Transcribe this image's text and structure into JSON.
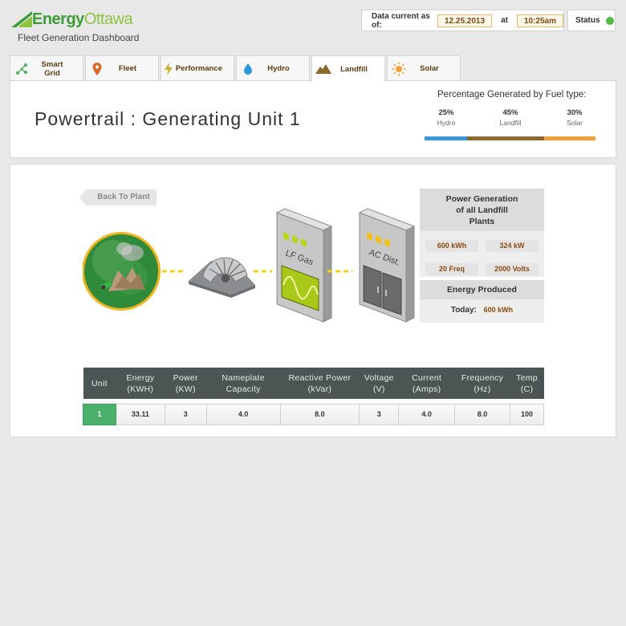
{
  "header": {
    "brand_energy": "Energy",
    "brand_city": "Ottawa",
    "subtitle": "Fleet Generation Dashboard",
    "data_current_label": "Data current as of:",
    "date": "12.25.2013",
    "at_label": "at",
    "time": "10:25am",
    "status_label": "Status",
    "status_color": "#56b848"
  },
  "tabs": [
    {
      "label": "Smart Grid",
      "icon": "network-icon"
    },
    {
      "label": "Fleet",
      "icon": "map-pin-icon"
    },
    {
      "label": "Performance",
      "icon": "lightning-icon"
    },
    {
      "label": "Hydro",
      "icon": "water-drop-icon"
    },
    {
      "label": "Landfill",
      "icon": "landfill-hill-icon",
      "active": true
    },
    {
      "label": "Solar",
      "icon": "sun-icon"
    }
  ],
  "unit": {
    "title": "Powertrail : Generating Unit 1"
  },
  "fuel": {
    "title": "Percentage Generated by Fuel type:",
    "items": [
      {
        "value": "25%",
        "name": "Hydro",
        "fraction": 0.25,
        "color": "#3a9ad9"
      },
      {
        "value": "45%",
        "name": "Landfill",
        "fraction": 0.45,
        "color": "#8a6a2c"
      },
      {
        "value": "30%",
        "name": "Solar",
        "fraction": 0.3,
        "color": "#f0a13a"
      }
    ]
  },
  "diagram": {
    "back_label": "Back To Plant",
    "cabinet1_label": "LF Gas",
    "cabinet2_label": "AC Dist."
  },
  "power_generation": {
    "title_line1": "Power Generation",
    "title_line2": "of all Landfill",
    "title_line3": "Plants",
    "energy": "600 kWh",
    "power": "324 kW",
    "freq": "20 Freq",
    "volts": "2000 Volts"
  },
  "energy_produced": {
    "title": "Energy Produced",
    "today_label": "Today:",
    "today_value": "600 kWh"
  },
  "table": {
    "headers": [
      [
        "Unit",
        ""
      ],
      [
        "Energy",
        "(KWH)"
      ],
      [
        "Power",
        "(KW)"
      ],
      [
        "Nameplate",
        "Capacity"
      ],
      [
        "Reactive Power",
        "(kVar)"
      ],
      [
        "Voltage",
        "(V)"
      ],
      [
        "Current",
        "(Amps)"
      ],
      [
        "Frequency",
        "(Hz)"
      ],
      [
        "Temp",
        "(C)"
      ]
    ],
    "rows": [
      [
        "1",
        "33.11",
        "3",
        "4.0",
        "8.0",
        "3",
        "4.0",
        "8.0",
        "100"
      ]
    ]
  }
}
